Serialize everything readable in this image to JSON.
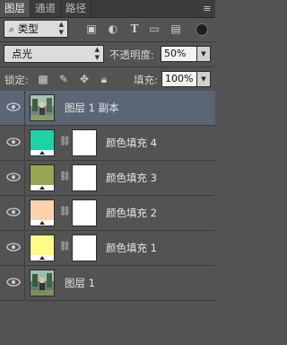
{
  "tabs": [
    "图层",
    "通道",
    "路径"
  ],
  "panel_menu_icon": "panel-menu-icon",
  "filter": {
    "type_label": "类型"
  },
  "blend": {
    "mode": "点光",
    "opacity_label": "不透明度:",
    "opacity_value": "50%"
  },
  "lock": {
    "label": "锁定:",
    "fill_label": "填充:",
    "fill_value": "100%"
  },
  "layers": [
    {
      "name": "图层 1 副本",
      "kind": "photo",
      "selected": true
    },
    {
      "name": "颜色填充 4",
      "kind": "fill",
      "color": "#1ed2a5"
    },
    {
      "name": "颜色填充 3",
      "kind": "fill",
      "color": "#9ba454"
    },
    {
      "name": "颜色填充 2",
      "kind": "fill",
      "color": "#fed2aa"
    },
    {
      "name": "颜色填充 1",
      "kind": "fill",
      "color": "#fffb87"
    },
    {
      "name": "图层 1",
      "kind": "photo",
      "selected": false
    }
  ],
  "colors": {
    "selected_row": "#5a6576",
    "panel_bg": "#535353"
  }
}
